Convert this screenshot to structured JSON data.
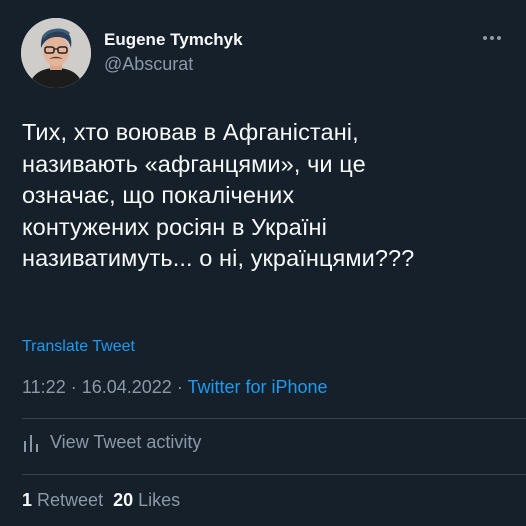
{
  "author": {
    "display_name": "Eugene Tymchyk",
    "handle": "@Abscurat",
    "avatar_icon": "user-photo-avatar"
  },
  "more_icon": "more-horizontal-icon",
  "tweet": {
    "text": "Тих, хто воював в Афганістані,\nназивають «афганцями», чи це\nозначає, що покалічених\nконтужених росіян в Україні\nназиватимуть... о ні, українцями???"
  },
  "translate_label": "Translate Tweet",
  "meta": {
    "time": "11:22",
    "separator1": " · ",
    "date": "16.04.2022",
    "separator2": " · ",
    "source": "Twitter for iPhone"
  },
  "activity": {
    "icon": "bar-chart-icon",
    "label": "View Tweet activity"
  },
  "stats": {
    "retweets_count": "1",
    "retweets_label": "Retweet",
    "likes_count": "20",
    "likes_label": "Likes"
  },
  "colors": {
    "background": "#15202b",
    "text": "#f7f9f9",
    "secondary": "#8b98a5",
    "accent": "#1d9bf0",
    "divider": "#38444d"
  }
}
